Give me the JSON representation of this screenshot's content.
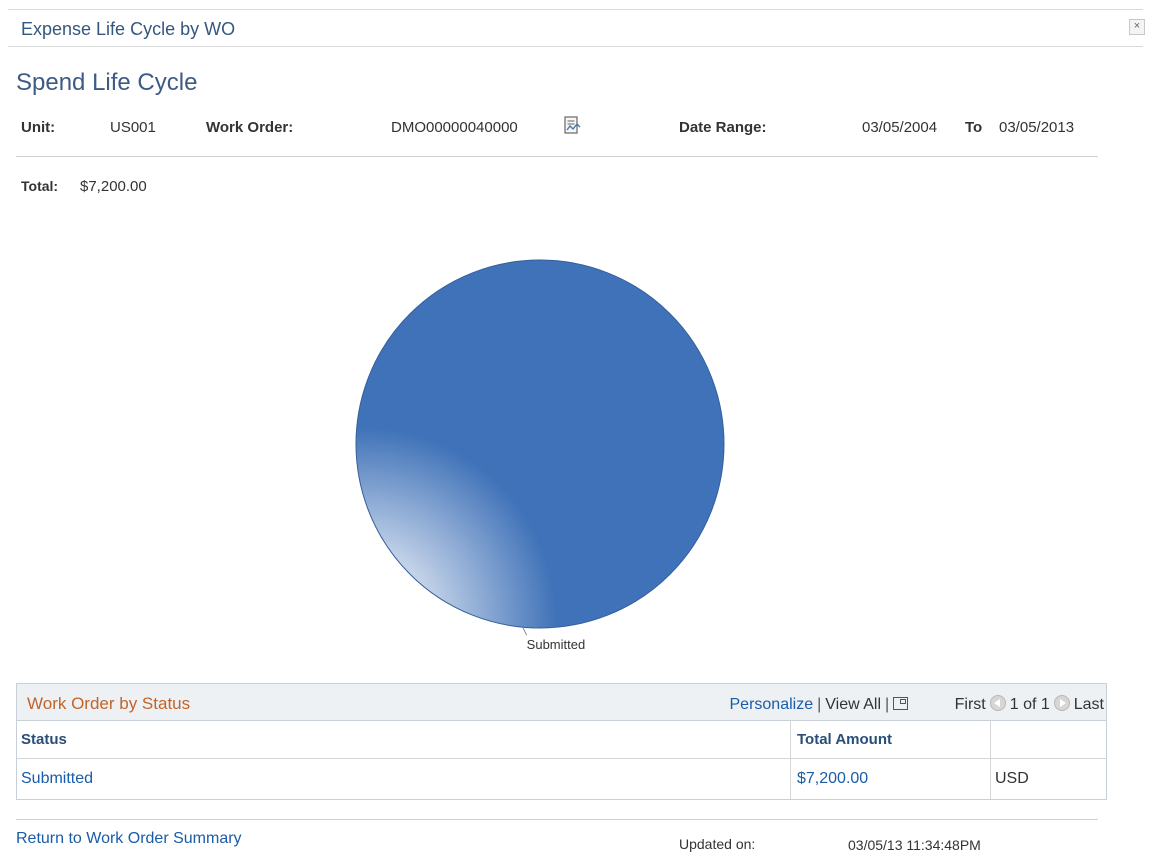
{
  "window": {
    "title": "Expense Life Cycle by WO",
    "close_glyph": "×"
  },
  "page": {
    "title": "Spend Life Cycle"
  },
  "fields": {
    "unit_label": "Unit:",
    "unit_value": "US001",
    "work_order_label": "Work Order:",
    "work_order_value": "DMO00000040000",
    "date_range_label": "Date Range:",
    "date_from": "03/05/2004",
    "to_label": "To",
    "date_to": "03/05/2013",
    "total_label": "Total:",
    "total_value": "$7,200.00"
  },
  "icons": {
    "work_order_details": "document-chart-icon"
  },
  "chart_data": {
    "type": "pie",
    "slices": [
      {
        "label": "Submitted",
        "value": 7200
      }
    ],
    "colors": [
      "#3f72b8"
    ]
  },
  "grid": {
    "title": "Work Order by Status",
    "personalize": "Personalize",
    "view_all": "View All",
    "first": "First",
    "paging": "1 of 1",
    "last": "Last",
    "columns": [
      "Status",
      "Total Amount",
      ""
    ],
    "rows": [
      {
        "status": "Submitted",
        "amount": "$7,200.00",
        "currency": "USD"
      }
    ]
  },
  "footer": {
    "return_link": "Return to Work Order Summary",
    "updated_label": "Updated on:",
    "updated_value": "03/05/13 11:34:48PM"
  },
  "colors": {
    "title_blue": "#3d5b85",
    "link_blue": "#1a5ca8",
    "grid_title": "#c2642a",
    "pie_blue": "#3f72b8"
  }
}
